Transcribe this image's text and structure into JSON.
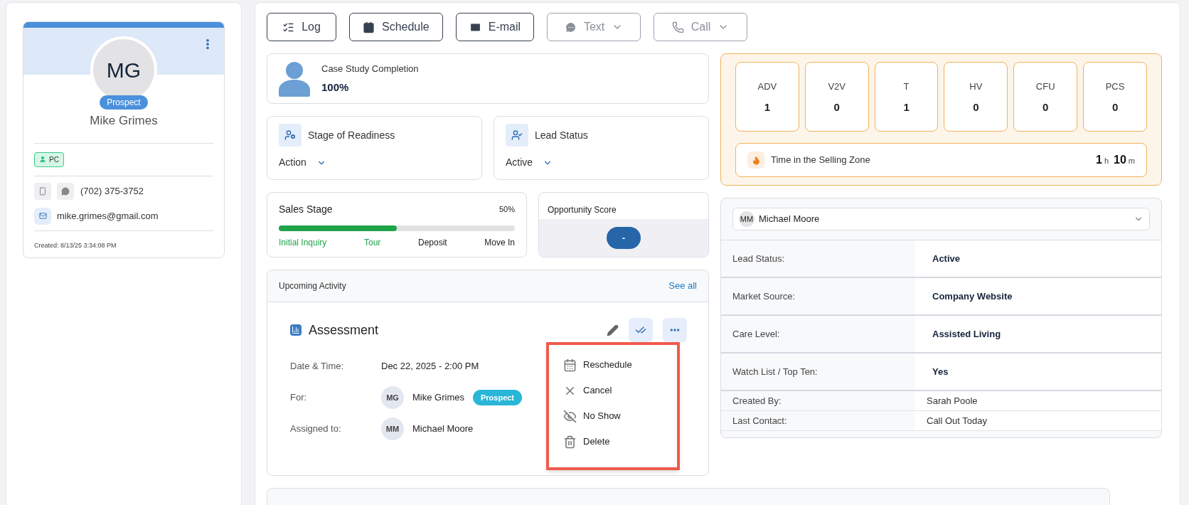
{
  "contact_card": {
    "initials": "MG",
    "badge": "Prospect",
    "name": "Mike Grimes",
    "tags": [
      {
        "label": "PC"
      }
    ],
    "phone": "(702) 375-3752",
    "email": "mike.grimes@gmail.com",
    "created": "Created: 8/13/25 3:34:08 PM"
  },
  "toolbar": [
    {
      "label": "Log",
      "kind": "log",
      "disabled": false,
      "dropdown": false
    },
    {
      "label": "Schedule",
      "kind": "schedule",
      "disabled": false,
      "dropdown": false
    },
    {
      "label": "E-mail",
      "kind": "email",
      "disabled": false,
      "dropdown": false
    },
    {
      "label": "Text",
      "kind": "text",
      "disabled": true,
      "dropdown": true
    },
    {
      "label": "Call",
      "kind": "call",
      "disabled": true,
      "dropdown": true
    }
  ],
  "case_study": {
    "title": "Case Study Completion",
    "value": "100%"
  },
  "status_cards": [
    {
      "kind": "readiness",
      "title": "Stage of Readiness",
      "value": "Action"
    },
    {
      "kind": "lead",
      "title": "Lead Status",
      "value": "Active"
    }
  ],
  "sales_stage": {
    "title": "Sales Stage",
    "percent": "50%",
    "level": 0.5,
    "steps": [
      {
        "label": "Initial Inquiry",
        "done": true
      },
      {
        "label": "Tour",
        "done": true
      },
      {
        "label": "Deposit",
        "done": false
      },
      {
        "label": "Move In",
        "done": false
      }
    ]
  },
  "opportunity_score": {
    "title": "Opportunity Score",
    "value": "-"
  },
  "upcoming_activity": {
    "title": "Upcoming Activity",
    "link": "See all",
    "activity": {
      "title": "Assessment",
      "fields": [
        {
          "kind": "text",
          "label": "Date & Time:",
          "value": "Dec 22, 2025 - 2:00 PM"
        },
        {
          "kind": "person",
          "label": "For:",
          "initials": "MG",
          "value": "Mike Grimes",
          "badge": "Prospect"
        },
        {
          "kind": "person",
          "label": "Assigned to:",
          "initials": "MM",
          "value": "Michael Moore"
        }
      ]
    },
    "menu": [
      {
        "kind": "reschedule",
        "label": "Reschedule"
      },
      {
        "kind": "cancel",
        "label": "Cancel"
      },
      {
        "kind": "noshow",
        "label": "No Show"
      },
      {
        "kind": "delete",
        "label": "Delete"
      }
    ]
  },
  "counters": [
    {
      "label": "ADV",
      "value": "1"
    },
    {
      "label": "V2V",
      "value": "0"
    },
    {
      "label": "T",
      "value": "1"
    },
    {
      "label": "HV",
      "value": "0"
    },
    {
      "label": "CFU",
      "value": "0"
    },
    {
      "label": "PCS",
      "value": "0"
    }
  ],
  "selling_zone": {
    "label": "Time in the Selling Zone",
    "hours": "1",
    "hours_unit": "h",
    "minutes": "10",
    "minutes_unit": "m"
  },
  "assignee_select": {
    "initials": "MM",
    "value": "Michael Moore"
  },
  "details": [
    {
      "label": "Lead Status:",
      "value": "Active",
      "emphasis": true
    },
    {
      "label": "Market Source:",
      "value": "Company Website",
      "emphasis": true
    },
    {
      "label": "Care Level:",
      "value": "Assisted Living",
      "emphasis": true
    },
    {
      "label": "Watch List / Top Ten:",
      "value": "Yes",
      "emphasis": true
    },
    {
      "label": "Created By:",
      "value": "Sarah Poole",
      "emphasis": false
    },
    {
      "label": "Last Contact:",
      "value": "Call Out Today",
      "emphasis": false
    }
  ]
}
